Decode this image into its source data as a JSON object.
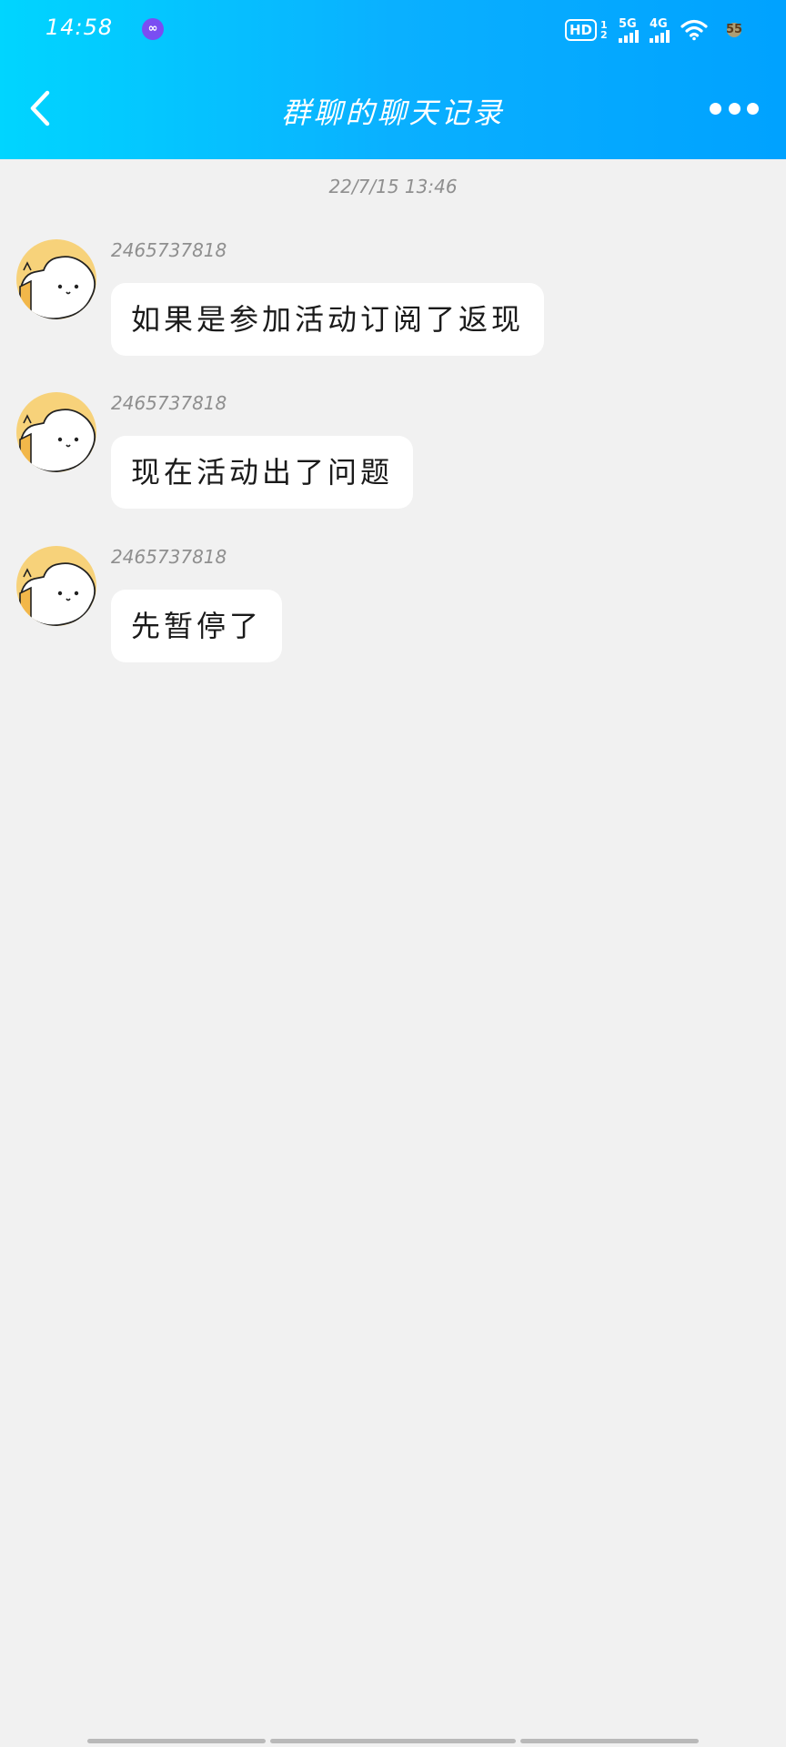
{
  "status_bar": {
    "time": "14:58",
    "app_glyph": "∞",
    "hd_label": "HD",
    "hd_sub": "1 2",
    "signal_1_label": "5G",
    "signal_2_label": "4G",
    "battery_level": "55",
    "icons": [
      "infinity-app-icon",
      "hd-voice-icon",
      "signal-5g-icon",
      "signal-4g-icon",
      "wifi-icon",
      "battery-icon"
    ]
  },
  "navbar": {
    "title": "群聊的聊天记录",
    "back_icon": "chevron-left-icon",
    "more_icon": "more-dots-icon"
  },
  "chat": {
    "timestamp": "22/7/15 13:46",
    "messages": [
      {
        "sender": "2465737818",
        "text": "如果是参加活动订阅了返现"
      },
      {
        "sender": "2465737818",
        "text": "现在活动出了问题"
      },
      {
        "sender": "2465737818",
        "text": "先暂停了"
      }
    ]
  },
  "colors": {
    "header_gradient_start": "#00d5ff",
    "header_gradient_end": "#00a2ff",
    "background": "#f1f1f1",
    "bubble": "#ffffff",
    "avatar_bg": "#f7d27a"
  }
}
